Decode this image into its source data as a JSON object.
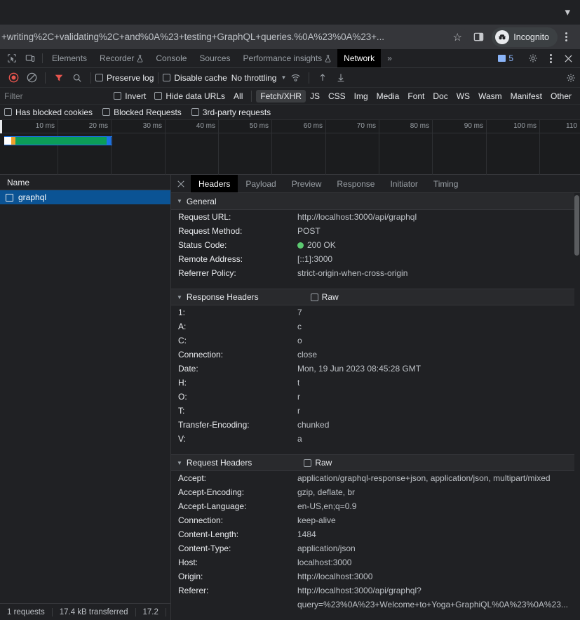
{
  "browser": {
    "url_text": "+writing%2C+validating%2C+and%0A%23+testing+GraphQL+queries.%0A%23%0A%23+...",
    "star_icon": "star-icon",
    "sidepanel_icon": "side-panel-icon",
    "incognito_label": "Incognito",
    "menu_icon": "three-dot-menu-icon",
    "minimize_chevron": "chevron-down-icon"
  },
  "devtools": {
    "tabs": [
      {
        "label": "Elements",
        "active": false,
        "flask": false
      },
      {
        "label": "Recorder",
        "active": false,
        "flask": true
      },
      {
        "label": "Console",
        "active": false,
        "flask": false
      },
      {
        "label": "Sources",
        "active": false,
        "flask": false
      },
      {
        "label": "Performance insights",
        "active": false,
        "flask": true
      },
      {
        "label": "Network",
        "active": true,
        "flask": false
      }
    ],
    "more_tabs_label": "»",
    "issues_count": "5",
    "inspect_icon": "inspect-element-icon",
    "device_icon": "device-toolbar-icon",
    "settings_icon": "gear-icon",
    "kebab_icon": "three-dot-menu-icon",
    "close_icon": "close-icon"
  },
  "network_toolbar": {
    "record_icon": "record-stop-icon",
    "clear_icon": "clear-network-icon",
    "filter_icon": "filter-funnel-icon",
    "search_icon": "search-icon",
    "preserve_log_label": "Preserve log",
    "preserve_log_checked": false,
    "disable_cache_label": "Disable cache",
    "disable_cache_checked": false,
    "throttling_value": "No throttling",
    "wifi_icon": "network-conditions-icon",
    "import_icon": "import-har-icon",
    "export_icon": "export-har-icon",
    "settings_icon": "gear-icon"
  },
  "filter_bar": {
    "placeholder": "Filter",
    "value": "",
    "invert_label": "Invert",
    "invert_checked": false,
    "hide_data_urls_label": "Hide data URLs",
    "hide_data_urls_checked": false,
    "types": [
      "All",
      "Fetch/XHR",
      "JS",
      "CSS",
      "Img",
      "Media",
      "Font",
      "Doc",
      "WS",
      "Wasm",
      "Manifest",
      "Other"
    ],
    "selected_type": "Fetch/XHR"
  },
  "filter_bar2": {
    "has_blocked_cookies_label": "Has blocked cookies",
    "has_blocked_cookies_checked": false,
    "blocked_requests_label": "Blocked Requests",
    "blocked_requests_checked": false,
    "third_party_label": "3rd-party requests",
    "third_party_checked": false
  },
  "overview": {
    "ticks": [
      "10 ms",
      "20 ms",
      "30 ms",
      "40 ms",
      "50 ms",
      "60 ms",
      "70 ms",
      "80 ms",
      "90 ms",
      "100 ms",
      "110"
    ],
    "bar_colors": {
      "white": "#ffffff",
      "orange": "#f0a02a",
      "green": "#0c9d58",
      "blue": "#1a73e8"
    }
  },
  "request_list": {
    "column_header": "Name",
    "rows": [
      {
        "name": "graphql",
        "selected": true,
        "icon": "document-icon"
      }
    ],
    "status": {
      "requests": "1 requests",
      "transferred": "17.4 kB transferred",
      "resources": "17.2 "
    }
  },
  "detail_panel": {
    "close_icon": "close-icon",
    "tabs": [
      {
        "label": "Headers",
        "active": true
      },
      {
        "label": "Payload",
        "active": false
      },
      {
        "label": "Preview",
        "active": false
      },
      {
        "label": "Response",
        "active": false
      },
      {
        "label": "Initiator",
        "active": false
      },
      {
        "label": "Timing",
        "active": false
      }
    ],
    "sections": [
      {
        "title": "General",
        "has_raw": false,
        "raw_label": "",
        "rows": [
          {
            "key": "Request URL:",
            "value": "http://localhost:3000/api/graphql",
            "status_dot": false
          },
          {
            "key": "Request Method:",
            "value": "POST",
            "status_dot": false
          },
          {
            "key": "Status Code:",
            "value": "200 OK",
            "status_dot": true
          },
          {
            "key": "Remote Address:",
            "value": "[::1]:3000",
            "status_dot": false
          },
          {
            "key": "Referrer Policy:",
            "value": "strict-origin-when-cross-origin",
            "status_dot": false
          }
        ]
      },
      {
        "title": "Response Headers",
        "has_raw": true,
        "raw_label": "Raw",
        "rows": [
          {
            "key": "1:",
            "value": "7",
            "status_dot": false
          },
          {
            "key": "A:",
            "value": "c",
            "status_dot": false
          },
          {
            "key": "C:",
            "value": "o",
            "status_dot": false
          },
          {
            "key": "Connection:",
            "value": "close",
            "status_dot": false
          },
          {
            "key": "Date:",
            "value": "Mon, 19 Jun 2023 08:45:28 GMT",
            "status_dot": false
          },
          {
            "key": "H:",
            "value": "t",
            "status_dot": false
          },
          {
            "key": "O:",
            "value": "r",
            "status_dot": false
          },
          {
            "key": "T:",
            "value": "r",
            "status_dot": false
          },
          {
            "key": "Transfer-Encoding:",
            "value": "chunked",
            "status_dot": false
          },
          {
            "key": "V:",
            "value": "a",
            "status_dot": false
          }
        ]
      },
      {
        "title": "Request Headers",
        "has_raw": true,
        "raw_label": "Raw",
        "rows": [
          {
            "key": "Accept:",
            "value": "application/graphql-response+json, application/json, multipart/mixed",
            "status_dot": false
          },
          {
            "key": "Accept-Encoding:",
            "value": "gzip, deflate, br",
            "status_dot": false
          },
          {
            "key": "Accept-Language:",
            "value": "en-US,en;q=0.9",
            "status_dot": false
          },
          {
            "key": "Connection:",
            "value": "keep-alive",
            "status_dot": false
          },
          {
            "key": "Content-Length:",
            "value": "1484",
            "status_dot": false
          },
          {
            "key": "Content-Type:",
            "value": "application/json",
            "status_dot": false
          },
          {
            "key": "Host:",
            "value": "localhost:3000",
            "status_dot": false
          },
          {
            "key": "Origin:",
            "value": "http://localhost:3000",
            "status_dot": false
          },
          {
            "key": "Referer:",
            "value": "http://localhost:3000/api/graphql?",
            "status_dot": false
          },
          {
            "key": "",
            "value": "query=%23%0A%23+Welcome+to+Yoga+GraphiQL%0A%23%0A%23...",
            "status_dot": false
          }
        ]
      }
    ]
  },
  "colors": {
    "accent_blue": "#8ab4f8",
    "selection_blue": "#0b5394",
    "status_green": "#5cc971",
    "record_red": "#e8554e",
    "filter_red": "#e8554e"
  }
}
